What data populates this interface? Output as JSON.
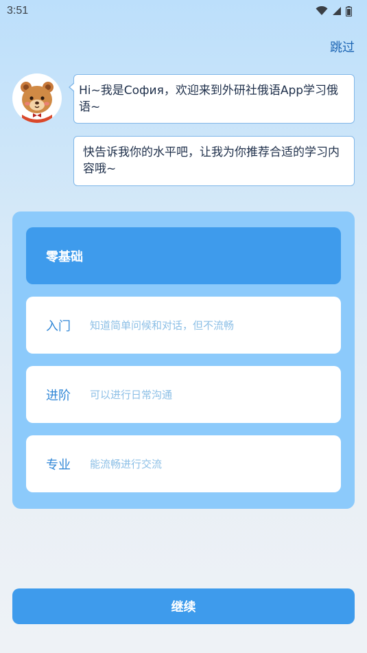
{
  "status_bar": {
    "time": "3:51",
    "icons": [
      "wifi-icon",
      "signal-icon",
      "battery-icon"
    ]
  },
  "header": {
    "skip_label": "跳过"
  },
  "chat": {
    "avatar_icon": "bear-avatar-icon",
    "messages": [
      "Hi~我是София，欢迎来到外研社俄语App学习俄语~",
      "快告诉我你的水平吧，让我为你推荐合适的学习内容哦~"
    ]
  },
  "levels": [
    {
      "name": "零基础",
      "description": "",
      "selected": true
    },
    {
      "name": "入门",
      "description": "知道简单问候和对话，但不流畅",
      "selected": false
    },
    {
      "name": "进阶",
      "description": "可以进行日常沟通",
      "selected": false
    },
    {
      "name": "专业",
      "description": "能流畅进行交流",
      "selected": false
    }
  ],
  "footer": {
    "continue_label": "继续"
  },
  "colors": {
    "accent": "#3e9bec",
    "panel": "#8ccafb",
    "link": "#1b64b3"
  }
}
